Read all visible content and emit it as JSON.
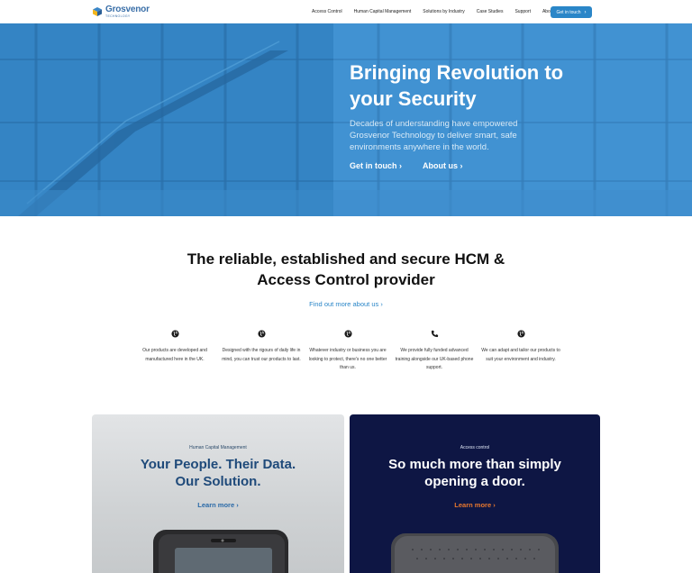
{
  "header": {
    "logo": {
      "name": "Grosvenor",
      "sub": "TECHNOLOGY"
    },
    "nav": [
      "Access Control",
      "Human Capital Management",
      "Solutions by Industry",
      "Case Studies",
      "Support",
      "About"
    ],
    "cta": "Get in touch",
    "colors": {
      "accent": "#2a86c8",
      "logo": "#3a6fa8"
    }
  },
  "hero": {
    "title": "Bringing Revolution to your Security",
    "text": "Decades of understanding have empowered Grosvenor Technology to deliver smart, safe environments anywhere in the world.",
    "links": [
      "Get in touch ›",
      "About us ›"
    ],
    "background": "#3d8fcf"
  },
  "provider": {
    "title_line1": "The reliable, established and secure HCM &",
    "title_line2": "Access Control provider",
    "link": "Find out more about us ›",
    "features": [
      {
        "icon": "globe-icon",
        "text": "Our products are developed and manufactured here in the UK."
      },
      {
        "icon": "globe-icon",
        "text": "Designed with the rigours of daily life in mind, you can trust our products to last."
      },
      {
        "icon": "globe-icon",
        "text": "Whatever industry or business you are looking to protect, there's no one better than us."
      },
      {
        "icon": "phone-icon",
        "text": "We provide fully funded advanced training alongside our UK-based phone support."
      },
      {
        "icon": "globe-icon",
        "text": "We can adapt and tailor our products to suit your environment and industry."
      }
    ]
  },
  "cards": [
    {
      "eyebrow": "Human Capital Management",
      "title_line1": "Your People. Their Data.",
      "title_line2": "Our Solution.",
      "link": "Learn more ›"
    },
    {
      "eyebrow": "Access control",
      "title_line1": "So much more than simply",
      "title_line2": "opening a door.",
      "link": "Learn more ›"
    }
  ]
}
